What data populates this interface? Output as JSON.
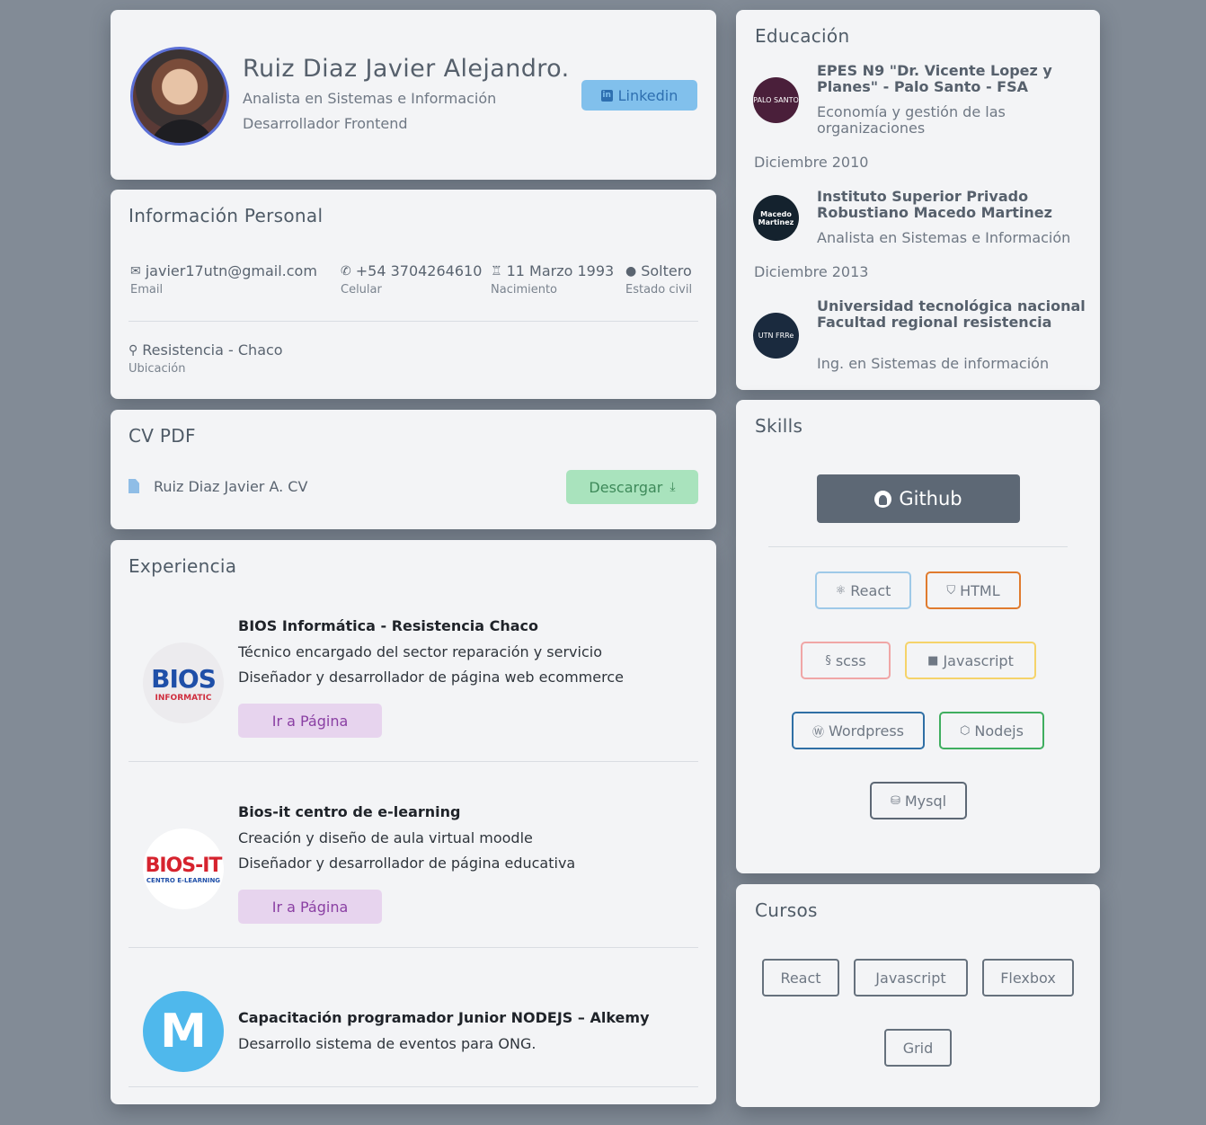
{
  "profile": {
    "name": "Ruiz Diaz Javier Alejandro.",
    "roles": [
      "Analista en Sistemas e Información",
      "Desarrollador Frontend"
    ],
    "linkedin_label": "Linkedin"
  },
  "personal_info": {
    "title": "Información Personal",
    "items": [
      {
        "value": "javier17utn@gmail.com",
        "label": "Email",
        "icon": "envelope-icon"
      },
      {
        "value": "+54 3704264610",
        "label": "Celular",
        "icon": "phone-icon"
      },
      {
        "value": "11 Marzo 1993",
        "label": "Nacimiento",
        "icon": "birthday-cake-icon"
      },
      {
        "value": "Soltero",
        "label": "Estado civil",
        "icon": "user-icon"
      }
    ],
    "location": {
      "value": "Resistencia - Chaco",
      "label": "Ubicación",
      "icon": "map-marker-icon"
    }
  },
  "cv": {
    "title": "CV PDF",
    "file_name": "Ruiz Diaz Javier A. CV",
    "download_label": "Descargar"
  },
  "experience": {
    "title": "Experiencia",
    "items": [
      {
        "company": "BIOS Informática - Resistencia Chaco",
        "lines": [
          "Técnico encargado del sector reparación y servicio",
          "Diseñador y desarrollador de página web ecommerce"
        ],
        "button": "Ir a Página",
        "logo_text": "BIOS",
        "logo_subtext": "INFORMATIC"
      },
      {
        "company": "Bios-it centro de e-learning",
        "lines": [
          "Creación y diseño de aula virtual moodle",
          "Diseñador y desarrollador de página educativa"
        ],
        "button": "Ir a Página",
        "logo_text": "BIOS-IT",
        "logo_subtext": "CENTRO E-LEARNING"
      },
      {
        "company": "Capacitación programador Junior NODEJS – Alkemy",
        "lines": [
          "Desarrollo sistema de eventos para ONG."
        ],
        "logo_text": "M"
      }
    ]
  },
  "education": {
    "title": "Educación",
    "items": [
      {
        "name": "EPES N9 \"Dr. Vicente Lopez y Planes\" - Palo Santo - FSA",
        "degree": "Economía y gestión de las organizaciones",
        "logo_text": "PALO SANTO",
        "date": "Diciembre 2010"
      },
      {
        "name": "Instituto Superior Privado Robustiano Macedo Martinez",
        "degree": "Analista en Sistemas e Información",
        "logo_text": "Macedo Martinez",
        "date": "Diciembre 2013"
      },
      {
        "name": "Universidad tecnológica nacional Facultad regional resistencia",
        "degree": "Ing. en Sistemas de información",
        "logo_text": "UTN FRRe"
      }
    ]
  },
  "skills": {
    "title": "Skills",
    "github_label": "Github",
    "items": [
      {
        "label": "React",
        "color": "#9ec9e8",
        "icon": "react-icon"
      },
      {
        "label": "HTML",
        "color": "#e07b2e",
        "icon": "html5-icon"
      },
      {
        "label": "scss",
        "color": "#f0a6a6",
        "icon": "sass-icon"
      },
      {
        "label": "Javascript",
        "color": "#f5d36a",
        "icon": "js-icon"
      },
      {
        "label": "Wordpress",
        "color": "#2f6fa5",
        "icon": "wordpress-icon"
      },
      {
        "label": "Nodejs",
        "color": "#3fae5f",
        "icon": "nodejs-icon"
      },
      {
        "label": "Mysql",
        "color": "#5d6875",
        "icon": "database-icon"
      }
    ]
  },
  "courses": {
    "title": "Cursos",
    "items": [
      "React",
      "Javascript",
      "Flexbox",
      "Grid"
    ]
  },
  "colors": {
    "background": "#828b96",
    "card": "#f3f4f6",
    "linkedin": "#81c0ec",
    "download": "#a9e3bd",
    "page_button": "#e7d4ee",
    "github": "#5d6875"
  }
}
